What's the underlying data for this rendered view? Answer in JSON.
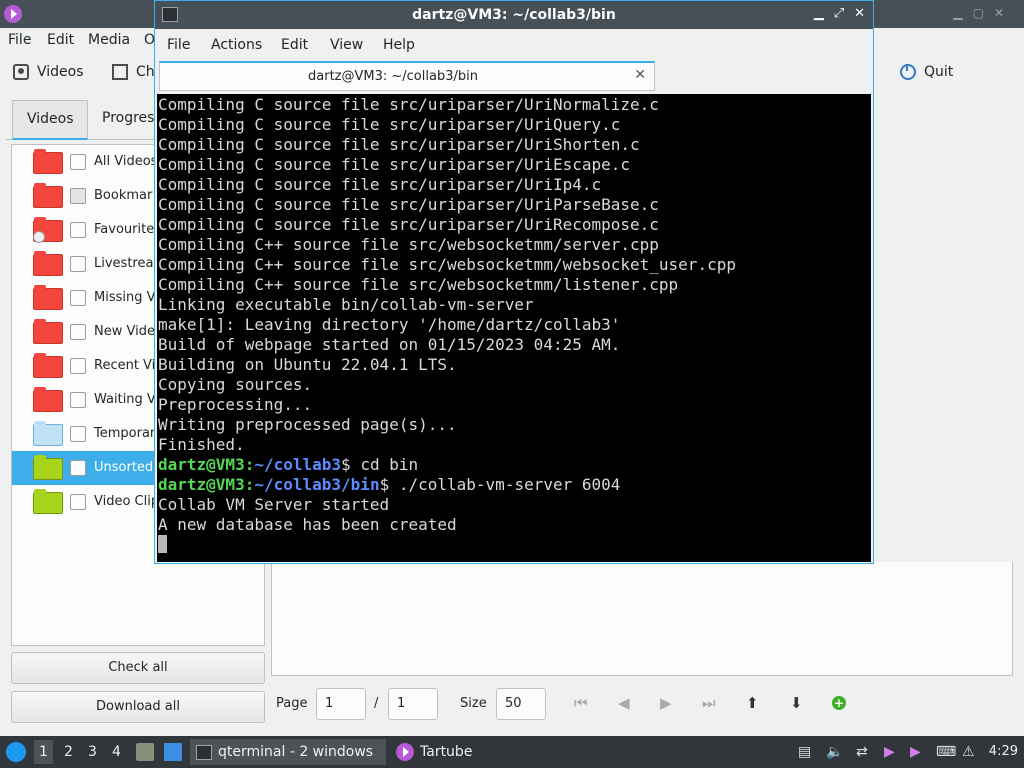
{
  "tartube": {
    "menu": [
      "File",
      "Edit",
      "Media",
      "O"
    ],
    "toolbar": {
      "videos": "Videos",
      "channels": "Ch",
      "quit": "Quit"
    },
    "tabs": [
      "Videos",
      "Progress"
    ],
    "folders": [
      {
        "label": "All Videos",
        "color": "red"
      },
      {
        "label": "Bookmar",
        "color": "red"
      },
      {
        "label": "Favourite",
        "color": "red"
      },
      {
        "label": "Livestrea",
        "color": "red"
      },
      {
        "label": "Missing V",
        "color": "red"
      },
      {
        "label": "New Vide",
        "color": "red"
      },
      {
        "label": "Recent Vi",
        "color": "red"
      },
      {
        "label": "Waiting V",
        "color": "red"
      },
      {
        "label": "Temporar",
        "color": "blue"
      },
      {
        "label": "Unsorted",
        "color": "green"
      },
      {
        "label": "Video Clip",
        "color": "green"
      }
    ],
    "check_all": "Check all",
    "download_all": "Download all",
    "pagebar": {
      "page_label": "Page",
      "page_value": "1",
      "sep": "/",
      "total": "1",
      "size_label": "Size",
      "size_value": "50"
    }
  },
  "terminal": {
    "title": "dartz@VM3: ~/collab3/bin",
    "menu": [
      "File",
      "Actions",
      "Edit",
      "View",
      "Help"
    ],
    "tab_label": "dartz@VM3: ~/collab3/bin",
    "lines": [
      "Compiling C source file src/uriparser/UriNormalize.c",
      "Compiling C source file src/uriparser/UriQuery.c",
      "Compiling C source file src/uriparser/UriShorten.c",
      "Compiling C source file src/uriparser/UriEscape.c",
      "Compiling C source file src/uriparser/UriIp4.c",
      "Compiling C source file src/uriparser/UriParseBase.c",
      "Compiling C source file src/uriparser/UriRecompose.c",
      "Compiling C++ source file src/websocketmm/server.cpp",
      "Compiling C++ source file src/websocketmm/websocket_user.cpp",
      "Compiling C++ source file src/websocketmm/listener.cpp",
      "Linking executable bin/collab-vm-server",
      "make[1]: Leaving directory '/home/dartz/collab3'",
      "Build of webpage started on 01/15/2023 04:25 AM.",
      "Building on Ubuntu 22.04.1 LTS.",
      "Copying sources.",
      "Preprocessing...",
      "Writing preprocessed page(s)...",
      "Finished."
    ],
    "prompt1": {
      "user": "dartz@VM3",
      "path": "~/collab3",
      "cmd": "$ cd bin"
    },
    "prompt2": {
      "user": "dartz@VM3",
      "path": "~/collab3/bin",
      "cmd": "$ ./collab-vm-server 6004"
    },
    "output": [
      "Collab VM Server started",
      "A new database has been created"
    ]
  },
  "taskbar": {
    "workspaces": [
      "1",
      "2",
      "3",
      "4"
    ],
    "task1": "qterminal - 2 windows",
    "task2": "Tartube",
    "clock": "4:29"
  }
}
